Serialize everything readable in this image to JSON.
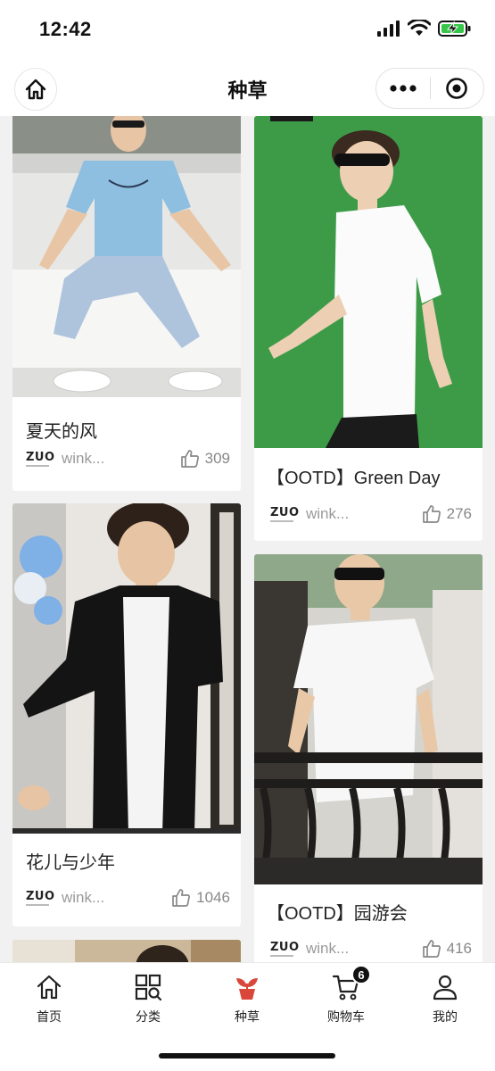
{
  "status": {
    "time": "12:42"
  },
  "nav": {
    "title": "种草"
  },
  "feed": {
    "cards": [
      {
        "title": "夏天的风",
        "author": "wink...",
        "likes": "309",
        "brand": "ZUO"
      },
      {
        "title": "【OOTD】Green Day",
        "author": "wink...",
        "likes": "276",
        "brand": "ZUO"
      },
      {
        "title": "花儿与少年",
        "author": "wink...",
        "likes": "1046",
        "brand": "ZUO"
      },
      {
        "title": "【OOTD】园游会",
        "author": "wink...",
        "likes": "416",
        "brand": "ZUO"
      }
    ]
  },
  "tabbar": {
    "tabs": [
      {
        "label": "首页",
        "icon": "home-icon"
      },
      {
        "label": "分类",
        "icon": "category-icon"
      },
      {
        "label": "种草",
        "icon": "sprout-icon"
      },
      {
        "label": "购物车",
        "icon": "cart-icon",
        "badge": "6"
      },
      {
        "label": "我的",
        "icon": "profile-icon"
      }
    ],
    "active_color": "#d9473a",
    "active_tab": "种草"
  }
}
